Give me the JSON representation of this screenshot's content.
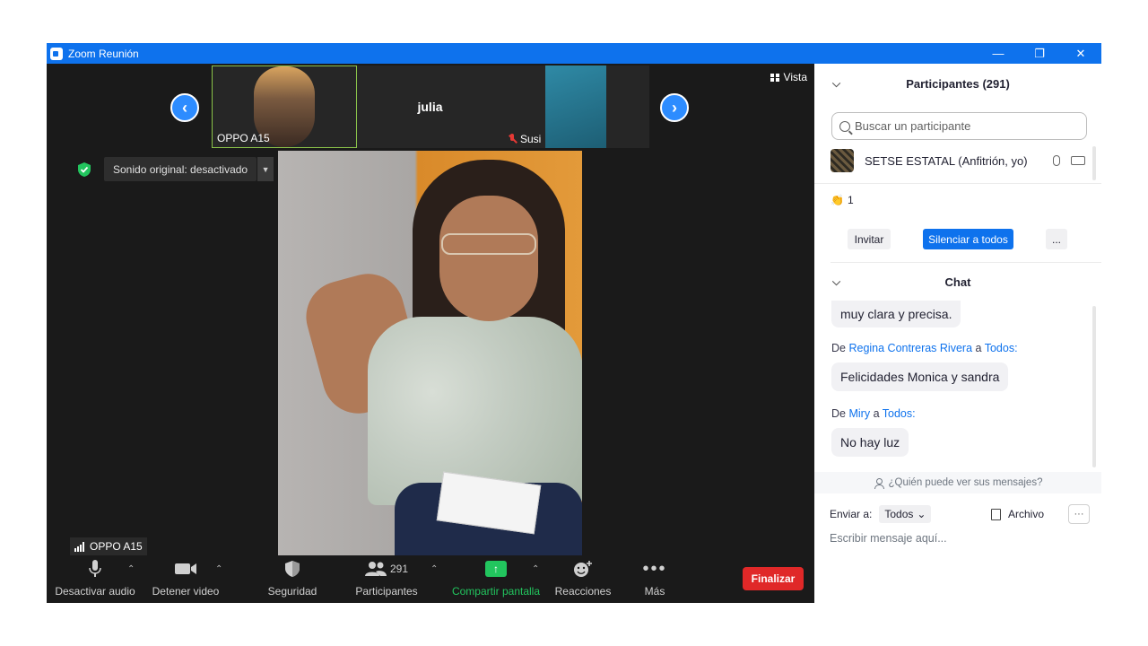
{
  "window": {
    "title": "Zoom Reunión",
    "controls": [
      "—",
      "❐",
      "✕"
    ]
  },
  "strip": {
    "tiles": [
      {
        "name": "OPPO A15"
      },
      {
        "name": "julia"
      },
      {
        "name": "Susi"
      }
    ]
  },
  "vista_label": "Vista",
  "sound_label": "Sonido original: desactivado",
  "self_label": "OPPO A15",
  "toolbar": {
    "audio": "Desactivar audio",
    "video": "Detener video",
    "security": "Seguridad",
    "participants": "Participantes",
    "participants_count": "291",
    "share": "Compartir pantalla",
    "reactions": "Reacciones",
    "more": "Más",
    "end": "Finalizar"
  },
  "panel": {
    "participants_title": "Participantes (291)",
    "search_placeholder": "Buscar un participante",
    "participant_name": "SETSE ESTATAL (Anfitrión, yo)",
    "clap_count": "1",
    "invite": "Invitar",
    "mute_all": "Silenciar a todos",
    "more": "...",
    "chat_title": "Chat",
    "messages": [
      {
        "from": "",
        "to": "",
        "text": "muy clara y precisa."
      },
      {
        "from": "Regina Contreras Rivera",
        "to": "Todos:",
        "text": "Felicidades Monica y sandra"
      },
      {
        "from": "Miry",
        "to": "Todos:",
        "text": "No hay luz"
      }
    ],
    "from_prefix": "De",
    "to_word": "a",
    "who_sees": "¿Quién puede ver sus mensajes?",
    "send_to": "Enviar a:",
    "send_target": "Todos",
    "file": "Archivo",
    "input_placeholder": "Escribir mensaje aquí..."
  },
  "colors": {
    "accent": "#0e72ed",
    "end": "#e02828",
    "share": "#22c55e",
    "active_tile": "#8bc34a"
  }
}
